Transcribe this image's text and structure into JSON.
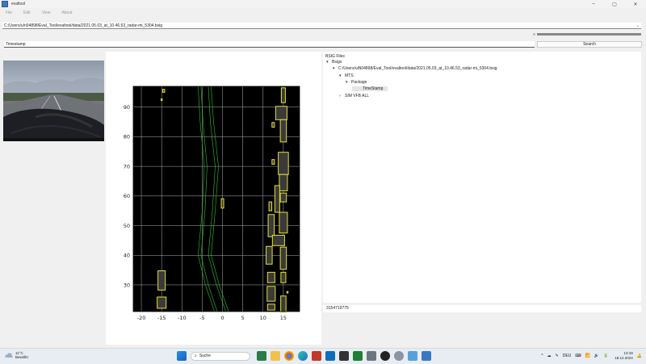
{
  "window": {
    "title": "evaltool",
    "minimize": "–",
    "maximize": "▢",
    "close": "✕"
  },
  "menu": [
    "File",
    "Edit",
    "View",
    "About"
  ],
  "path_field": {
    "value": "C:/Users/u/n04898/Eval_Tool/evaltool/data/2021.05.03_at_10.46.53_radar-mi_5304.bsig"
  },
  "progress": {
    "fraction": 1.0
  },
  "timestamp_field": {
    "value": "Timestamp"
  },
  "search_button": {
    "label": "Search"
  },
  "tree": {
    "header": "BSIG Files",
    "rows": [
      {
        "indent": 0,
        "arrow": "▾",
        "label": "Bsigs"
      },
      {
        "indent": 1,
        "arrow": "▾",
        "label": "C:/Users/uiN04898/Eval_Tool/evaltool/data/2021.05.03_at_10.46.53_radar-mi_5304.bsig"
      },
      {
        "indent": 2,
        "arrow": "▾",
        "label": "MTS"
      },
      {
        "indent": 3,
        "arrow": "▾",
        "label": "Package"
      },
      {
        "indent": 4,
        "arrow": "",
        "label": "TimeStamp",
        "selected": true
      },
      {
        "indent": 2,
        "arrow": "›",
        "label": "SIM VFB ALL"
      }
    ]
  },
  "status": {
    "value": "3154719775"
  },
  "chart_data": {
    "type": "scatter",
    "title": "",
    "xlabel": "",
    "ylabel": "",
    "xlim": [
      -22,
      19
    ],
    "ylim": [
      21,
      97
    ],
    "xticks": [
      -20,
      -15,
      -10,
      -5,
      0,
      5,
      10,
      15
    ],
    "yticks": [
      30,
      40,
      50,
      60,
      70,
      80,
      90
    ],
    "grid": true,
    "background": "#000000",
    "box_color": "#e8e030",
    "lane_color": "#30c030",
    "objects": [
      {
        "x": -15,
        "y": 31.5,
        "w": 1.8,
        "h": 6.5
      },
      {
        "x": -15,
        "y": 24.0,
        "w": 2.2,
        "h": 3.8
      },
      {
        "x": -14.5,
        "y": 95.5,
        "w": 0.5,
        "h": 1.0
      },
      {
        "x": -15,
        "y": 92.5,
        "w": 0.3,
        "h": 0.5
      },
      {
        "x": 0,
        "y": 57.5,
        "w": 0.6,
        "h": 3.2
      },
      {
        "x": 15,
        "y": 94.0,
        "w": 1.0,
        "h": 5.0
      },
      {
        "x": 14.5,
        "y": 88.0,
        "w": 2.8,
        "h": 4.5
      },
      {
        "x": 15,
        "y": 82.0,
        "w": 1.5,
        "h": 7.5
      },
      {
        "x": 12.5,
        "y": 84.0,
        "w": 0.6,
        "h": 1.6
      },
      {
        "x": 15,
        "y": 71.0,
        "w": 2.5,
        "h": 7.5
      },
      {
        "x": 12.5,
        "y": 71.5,
        "w": 0.6,
        "h": 1.6
      },
      {
        "x": 15,
        "y": 64.5,
        "w": 2.0,
        "h": 5.5
      },
      {
        "x": 13.5,
        "y": 59.0,
        "w": 1.2,
        "h": 9.0
      },
      {
        "x": 15,
        "y": 59.5,
        "w": 1.5,
        "h": 3.0
      },
      {
        "x": 11.8,
        "y": 56.5,
        "w": 0.7,
        "h": 3.0
      },
      {
        "x": 12.0,
        "y": 50.0,
        "w": 1.5,
        "h": 7.5
      },
      {
        "x": 15.0,
        "y": 51.0,
        "w": 2.0,
        "h": 7.0
      },
      {
        "x": 13.8,
        "y": 45.0,
        "w": 3.0,
        "h": 3.5
      },
      {
        "x": 11.5,
        "y": 40.0,
        "w": 1.5,
        "h": 6.0
      },
      {
        "x": 15,
        "y": 39.0,
        "w": 1.5,
        "h": 7.5
      },
      {
        "x": 12,
        "y": 32.5,
        "w": 1.8,
        "h": 3.5
      },
      {
        "x": 15,
        "y": 32.5,
        "w": 1.2,
        "h": 3.5
      },
      {
        "x": 12,
        "y": 27.0,
        "w": 2.0,
        "h": 5.0
      },
      {
        "x": 16,
        "y": 27.5,
        "w": 0.3,
        "h": 0.5
      },
      {
        "x": 15,
        "y": 23.5,
        "w": 1.3,
        "h": 5.5
      },
      {
        "x": 12,
        "y": 22.5,
        "w": 1.8,
        "h": 2.0
      }
    ],
    "lanes": [
      {
        "name": "",
        "points": [
          [
            -3.5,
            97
          ],
          [
            -3.0,
            85
          ],
          [
            -1.8,
            70
          ],
          [
            -2.5,
            55
          ],
          [
            -3.5,
            40
          ],
          [
            -1.5,
            30
          ],
          [
            0.8,
            21
          ]
        ]
      },
      {
        "name": "",
        "points": [
          [
            -2.8,
            97
          ],
          [
            -2.2,
            85
          ],
          [
            -1.0,
            70
          ],
          [
            -1.8,
            55
          ],
          [
            -2.8,
            40
          ],
          [
            -0.8,
            30
          ],
          [
            1.5,
            21
          ]
        ]
      },
      {
        "name": "",
        "points": [
          [
            -6.0,
            97
          ],
          [
            -5.5,
            85
          ],
          [
            -4.5,
            70
          ],
          [
            -5.0,
            55
          ],
          [
            -6.0,
            40
          ],
          [
            -4.2,
            30
          ],
          [
            -2.0,
            21
          ]
        ]
      },
      {
        "name": "",
        "points": [
          [
            -5.3,
            97
          ],
          [
            -4.8,
            85
          ],
          [
            -3.8,
            70
          ],
          [
            -4.3,
            55
          ],
          [
            -5.3,
            40
          ],
          [
            -3.5,
            30
          ],
          [
            -1.3,
            21
          ]
        ]
      }
    ]
  },
  "taskbar": {
    "weather_temp": "11°C",
    "weather_desc": "Bewölkt",
    "search_placeholder": "Suche",
    "tray_lang": "DEU",
    "time": "13:18",
    "date": "18.12.2024",
    "tray_icons": [
      "^",
      "☁",
      "✎",
      "⌨",
      "📶",
      "🔊",
      "🔋",
      "🔔"
    ]
  }
}
